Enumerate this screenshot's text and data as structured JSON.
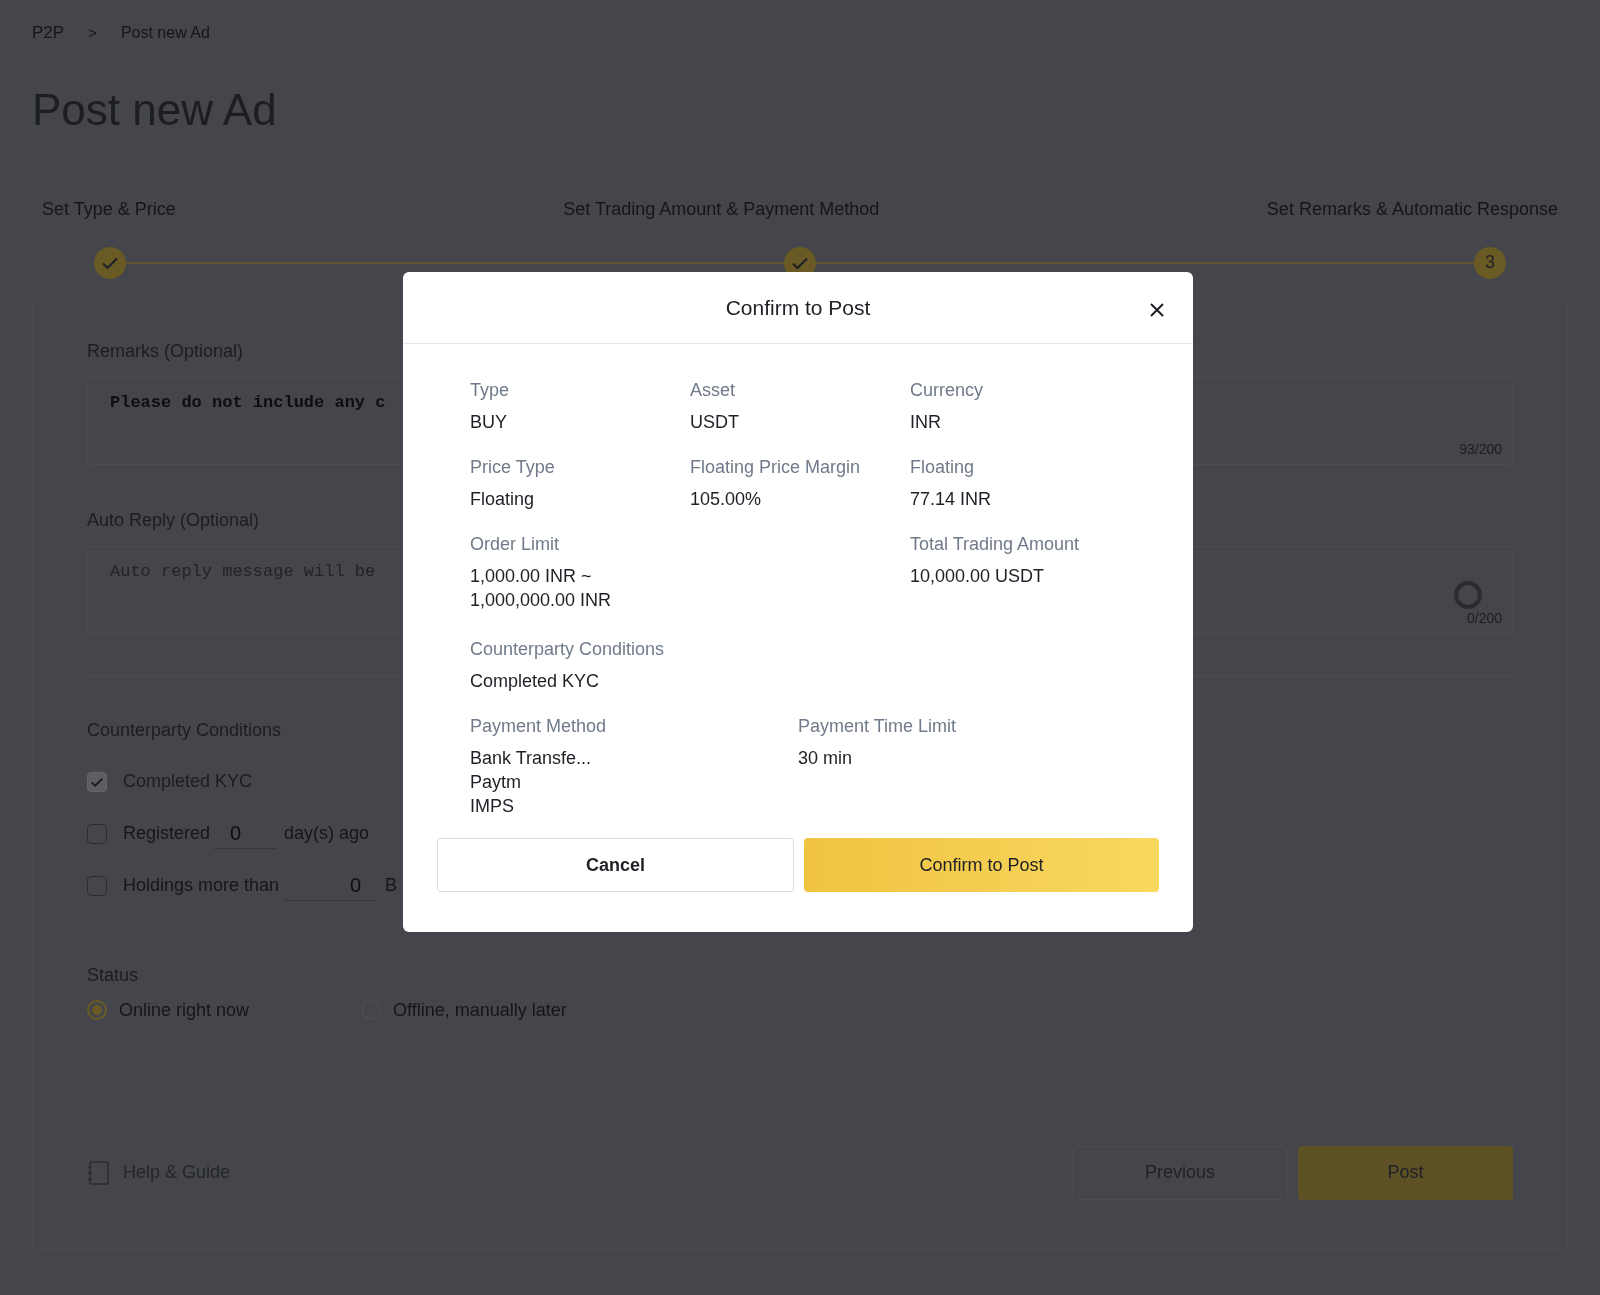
{
  "breadcrumb": {
    "items": [
      "P2P",
      "Post new Ad"
    ],
    "separator": ">"
  },
  "page_title": "Post new Ad",
  "steps": [
    {
      "label": "Set Type & Price",
      "kind": "done"
    },
    {
      "label": "Set Trading Amount & Payment Method",
      "kind": "done"
    },
    {
      "label": "Set Remarks & Automatic Response",
      "kind": "current",
      "number": "3"
    }
  ],
  "remarks": {
    "label": "Remarks (Optional)",
    "value": "Please do not include any c",
    "counter": "93/200"
  },
  "auto_reply": {
    "label": "Auto Reply (Optional)",
    "placeholder": "Auto reply message will be",
    "counter": "0/200"
  },
  "counterparty_conditions": {
    "label": "Counterparty Conditions",
    "options": [
      {
        "kind": "plain",
        "label": "Completed KYC",
        "checked": true,
        "disabled": true
      },
      {
        "kind": "days",
        "label": "Registered",
        "checked": false,
        "disabled": false,
        "value": "0",
        "suffix": "day(s) ago"
      },
      {
        "kind": "holdings",
        "label": "Holdings more than",
        "checked": false,
        "disabled": false,
        "value": "0",
        "suffix": "B"
      }
    ]
  },
  "status": {
    "label": "Status",
    "options": [
      {
        "label": "Online right now",
        "selected": true
      },
      {
        "label": "Offline, manually later",
        "selected": false
      }
    ]
  },
  "help_link": "Help & Guide",
  "buttons": {
    "previous": "Previous",
    "post": "Post"
  },
  "modal": {
    "title": "Confirm to Post",
    "summary": [
      {
        "label": "Type",
        "value": "BUY"
      },
      {
        "label": "Asset",
        "value": "USDT"
      },
      {
        "label": "Currency",
        "value": "INR"
      },
      {
        "label": "Price Type",
        "value": "Floating"
      },
      {
        "label": "Floating Price Margin",
        "value": "105.00%"
      },
      {
        "label": "Floating",
        "value": "77.14 INR"
      }
    ],
    "order_limit": {
      "label": "Order Limit",
      "values": [
        "1,000.00 INR ~",
        "1,000,000.00 INR"
      ]
    },
    "total_trading_amount": {
      "label": "Total Trading Amount",
      "value": "10,000.00 USDT"
    },
    "counterparty_conditions": {
      "label": "Counterparty Conditions",
      "value": "Completed KYC"
    },
    "payment_method": {
      "label": "Payment Method",
      "values": [
        "Bank Transfe...",
        "Paytm",
        "IMPS"
      ]
    },
    "payment_time_limit": {
      "label": "Payment Time Limit",
      "value": "30 min"
    },
    "cancel": "Cancel",
    "confirm": "Confirm to Post"
  }
}
